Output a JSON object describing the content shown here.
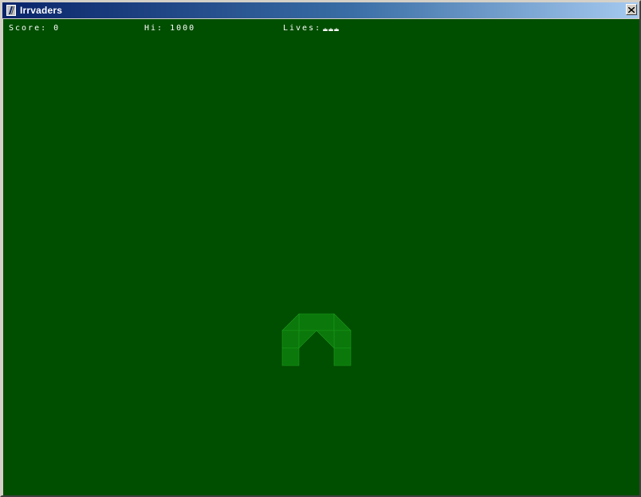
{
  "window": {
    "title": "Irrvaders",
    "icon": "irrlicht-app-icon"
  },
  "hud": {
    "score_label": "Score:",
    "score_value": "0",
    "hi_label": "Hi:",
    "hi_value": "1000",
    "lives_label": "Lives:",
    "lives_count": 3
  },
  "colors": {
    "background": "#004e00",
    "bunker": "#0a780a",
    "hud_text": "#ffffff"
  }
}
